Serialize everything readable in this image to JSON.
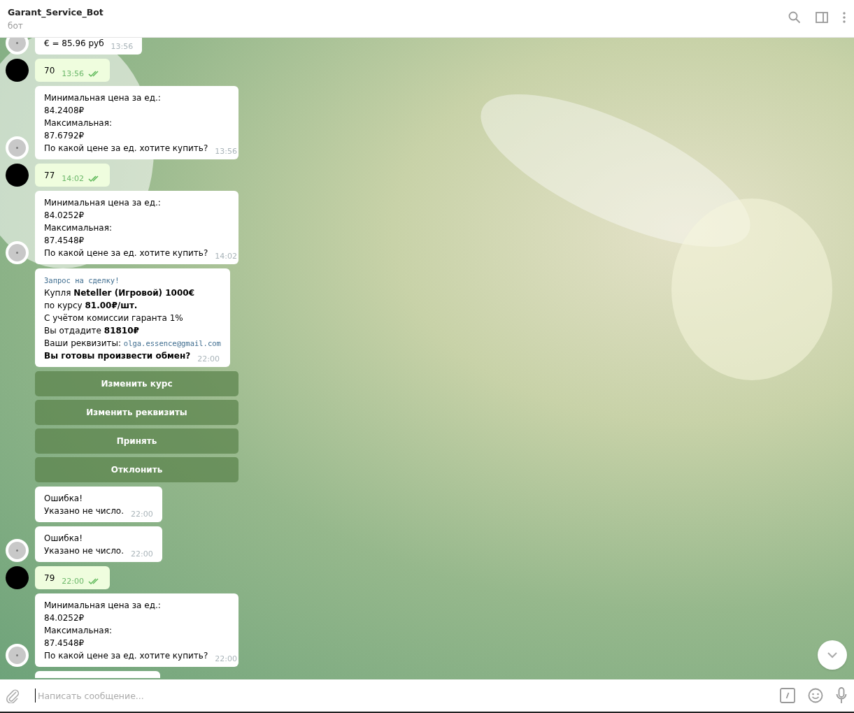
{
  "header": {
    "title": "Garant_Service_Bot",
    "subtitle": "бот"
  },
  "messages": [
    {
      "kind": "in",
      "lines": [
        {
          "text": "€ = 85.96 руб"
        }
      ],
      "time": "13:56",
      "avatar": true
    },
    {
      "kind": "out",
      "lines": [
        {
          "text": "70"
        }
      ],
      "time": "13:56",
      "read": true,
      "avatar": true
    },
    {
      "kind": "in",
      "lines": [
        {
          "text": "Минимальная цена за ед.:"
        },
        {
          "text": "84.2408₽"
        },
        {
          "text": "Максимальная:"
        },
        {
          "text": "87.6792₽"
        },
        {
          "text": "По какой цене за ед. хотите купить?"
        }
      ],
      "time": "13:56",
      "avatar": true
    },
    {
      "kind": "out",
      "lines": [
        {
          "text": "77"
        }
      ],
      "time": "14:02",
      "read": true,
      "avatar": true
    },
    {
      "kind": "in",
      "lines": [
        {
          "text": "Минимальная цена за ед.:"
        },
        {
          "text": "84.0252₽"
        },
        {
          "text": "Максимальная:"
        },
        {
          "text": "87.4548₽"
        },
        {
          "text": "По какой цене за ед. хотите купить?"
        }
      ],
      "time": "14:02",
      "avatar": true
    },
    {
      "kind": "in",
      "lines": [
        {
          "code": "Запрос на сделку!"
        },
        {
          "text": "Купля **Neteller (Игровой) 1000€**"
        },
        {
          "text": "по курсу **81.00₽/шт.**"
        },
        {
          "text": "С учётом комиссии гаранта 1%"
        },
        {
          "text": "Вы отдадите **81810₽**"
        },
        {
          "text": "Ваши реквизиты: ",
          "code": "olga.essence@gmail.com"
        },
        {
          "text": "**Вы готовы произвести обмен?**"
        }
      ],
      "time": "22:00",
      "avatar": false
    },
    {
      "kind": "keyboard",
      "buttons": [
        "Изменить курс",
        "Изменить реквизиты",
        "Принять",
        "Отклонить"
      ]
    },
    {
      "kind": "in",
      "lines": [
        {
          "text": "Ошибка!"
        },
        {
          "text": "Указано не число."
        }
      ],
      "time": "22:00",
      "avatar": false
    },
    {
      "kind": "in",
      "lines": [
        {
          "text": "Ошибка!"
        },
        {
          "text": "Указано не число."
        }
      ],
      "time": "22:00",
      "avatar": true
    },
    {
      "kind": "out",
      "lines": [
        {
          "text": "79"
        }
      ],
      "time": "22:00",
      "read": true,
      "avatar": true
    },
    {
      "kind": "in",
      "lines": [
        {
          "text": "Минимальная цена за ед.:"
        },
        {
          "text": "84.0252₽"
        },
        {
          "text": "Максимальная:"
        },
        {
          "text": "87.4548₽"
        },
        {
          "text": "По какой цене за ед. хотите купить?"
        }
      ],
      "time": "22:00",
      "avatar": true
    },
    {
      "kind": "stub"
    }
  ],
  "input": {
    "placeholder": "Написать сообщение..."
  }
}
